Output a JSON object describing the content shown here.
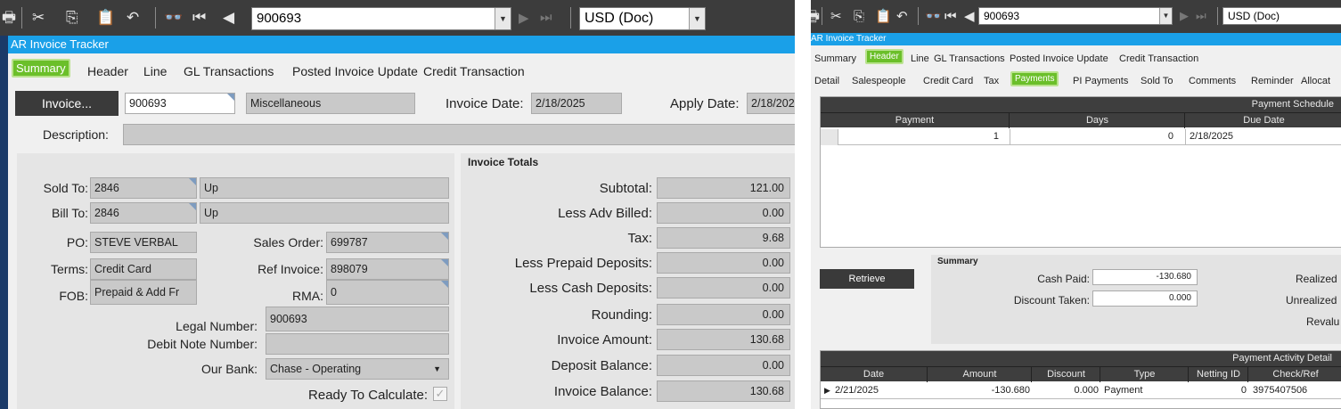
{
  "left": {
    "toolbar": {
      "icons": [
        "printer-icon",
        "scissors-icon",
        "copy-icon",
        "paste-icon",
        "undo-icon",
        "binoculars-icon",
        "first-record-icon",
        "previous-record-icon"
      ],
      "record": "900693",
      "currency": "USD (Doc)",
      "glyphs": {
        "printer": "🖶",
        "scissors": "✂",
        "copy": "⎘",
        "paste": "📋",
        "undo": "↶",
        "binoculars": "👓",
        "first": "⏮",
        "prev": "◀",
        "next": "▶",
        "last": "⏭",
        "down": "▼"
      }
    },
    "title": "AR Invoice Tracker",
    "tabs": [
      "Summary",
      "Header",
      "Line",
      "GL Transactions",
      "Posted Invoice Update",
      "Credit Transaction"
    ],
    "active_tab": "Summary",
    "invoice_button": "Invoice...",
    "invoice_num": "900693",
    "invoice_type": "Miscellaneous",
    "invoice_date_label": "Invoice Date:",
    "invoice_date": "2/18/2025",
    "apply_date_label": "Apply Date:",
    "apply_date": "2/18/202",
    "description_label": "Description:",
    "description": "",
    "sold_to_label": "Sold To:",
    "sold_to_id": "2846",
    "sold_to_name": "Up",
    "bill_to_label": "Bill To:",
    "bill_to_id": "2846",
    "bill_to_name": "Up",
    "po_label": "PO:",
    "po": "STEVE VERBAL",
    "sales_order_label": "Sales Order:",
    "sales_order": "699787",
    "terms_label": "Terms:",
    "terms": "Credit Card",
    "ref_invoice_label": "Ref Invoice:",
    "ref_invoice": "898079",
    "fob_label": "FOB:",
    "fob": "Prepaid & Add Fr",
    "rma_label": "RMA:",
    "rma": "0",
    "legal_number_label": "Legal Number:",
    "legal_number": "900693",
    "debit_note_label": "Debit Note Number:",
    "debit_note": "",
    "our_bank_label": "Our Bank:",
    "our_bank": "Chase - Operating",
    "ready_label": "Ready To Calculate:",
    "ready_checked": true,
    "totals_title": "Invoice Totals",
    "totals": [
      {
        "label": "Subtotal:",
        "value": "121.00"
      },
      {
        "label": "Less Adv Billed:",
        "value": "0.00"
      },
      {
        "label": "Tax:",
        "value": "9.68"
      },
      {
        "label": "Less Prepaid Deposits:",
        "value": "0.00"
      },
      {
        "label": "Less Cash Deposits:",
        "value": "0.00"
      },
      {
        "label": "Rounding:",
        "value": "0.00"
      },
      {
        "label": "Invoice Amount:",
        "value": "130.68"
      },
      {
        "label": "Deposit Balance:",
        "value": "0.00"
      },
      {
        "label": "Invoice Balance:",
        "value": "130.68"
      }
    ]
  },
  "right": {
    "record": "900693",
    "currency": "USD (Doc)",
    "title": "AR Invoice Tracker",
    "tabs": [
      "Summary",
      "Header",
      "Line",
      "GL Transactions",
      "Posted Invoice Update",
      "Credit Transaction"
    ],
    "active_tab": "Header",
    "subtabs": [
      "Detail",
      "Salespeople",
      "Credit Card",
      "Tax",
      "Payments",
      "PI Payments",
      "Sold To",
      "Comments",
      "Reminder",
      "Allocat"
    ],
    "active_subtab": "Payments",
    "schedule": {
      "title": "Payment Schedule",
      "columns": [
        "Payment",
        "Days",
        "Due Date"
      ],
      "rows": [
        [
          "1",
          "0",
          "2/18/2025"
        ]
      ]
    },
    "retrieve_button": "Retrieve",
    "summary_title": "Summary",
    "cash_paid_label": "Cash Paid:",
    "cash_paid": "-130.680",
    "discount_taken_label": "Discount Taken:",
    "discount_taken": "0.000",
    "realized_label": "Realized",
    "unrealized_label": "Unrealized",
    "reval_label": "Revalu",
    "activity": {
      "title": "Payment Activity Detail",
      "columns": [
        "Date",
        "Amount",
        "Discount",
        "Type",
        "Netting ID",
        "Check/Ref"
      ],
      "rows": [
        [
          "2/21/2025",
          "-130.680",
          "0.000",
          "Payment",
          "0",
          "3975407506"
        ]
      ]
    }
  }
}
